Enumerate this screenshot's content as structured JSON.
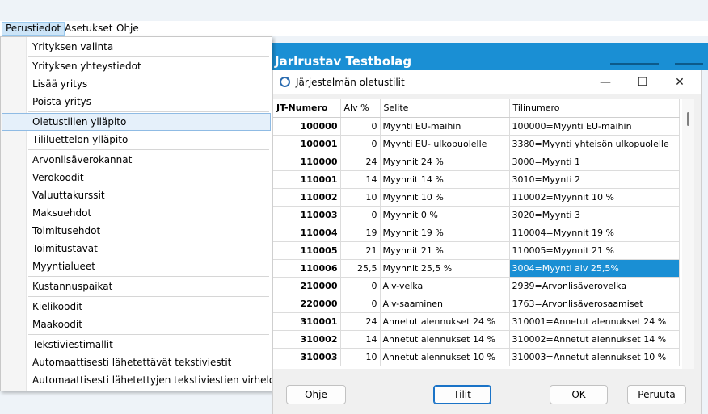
{
  "menubar": {
    "items": [
      "Perustiedot",
      "Asetukset",
      "Ohje"
    ]
  },
  "app": {
    "title": "Jarlrustav Testbolag"
  },
  "dropdown": {
    "items": [
      "Yrityksen valinta",
      "Yrityksen yhteystiedot",
      "Lisää yritys",
      "Poista yritys",
      "Oletustilien ylläpito",
      "Tililuettelon ylläpito",
      "Arvonlisäverokannat",
      "Verokoodit",
      "Valuuttakurssit",
      "Maksuehdot",
      "Toimitusehdot",
      "Toimitustavat",
      "Myyntialueet",
      "Kustannuspaikat",
      "Kielikoodit",
      "Maakoodit",
      "Tekstiviestimallit",
      "Automaattisesti lähetettävät tekstiviestit",
      "Automaattisesti lähetettyjen tekstiviestien virheloki"
    ],
    "active_item": "Oletustilien ylläpito"
  },
  "dialog": {
    "title": "Järjestelmän oletustilit",
    "icon": "refresh-app-icon",
    "window_buttons": {
      "minimize": "—",
      "maximize": "☐",
      "close": "✕"
    },
    "columns": [
      "JT-Numero",
      "Alv %",
      "Selite",
      "Tilinumero"
    ],
    "rows": [
      [
        "100000",
        "0",
        "Myynti EU-maihin",
        "100000=Myynti EU-maihin"
      ],
      [
        "100001",
        "0",
        "Myynti EU- ulkopuolelle",
        "3380=Myynti yhteisön ulkopuolelle"
      ],
      [
        "110000",
        "24",
        "Myynnit 24 %",
        "3000=Myynti 1"
      ],
      [
        "110001",
        "14",
        "Myynnit 14 %",
        "3010=Myynti 2"
      ],
      [
        "110002",
        "10",
        "Myynnit 10 %",
        "110002=Myynnit 10 %"
      ],
      [
        "110003",
        "0",
        "Myynnit 0 %",
        "3020=Myynti 3"
      ],
      [
        "110004",
        "19",
        "Myynnit 19 %",
        "110004=Myynnit 19 %"
      ],
      [
        "110005",
        "21",
        "Myynnit 21 %",
        "110005=Myynnit 21 %"
      ],
      [
        "110006",
        "25,5",
        "Myynnit 25,5 %",
        "3004=Myynti alv 25,5%"
      ],
      [
        "210000",
        "0",
        "Alv-velka",
        "2939=Arvonlisäverovelka"
      ],
      [
        "220000",
        "0",
        "Alv-saaminen",
        "1763=Arvonlisäverosaamiset"
      ],
      [
        "310001",
        "24",
        "Annetut alennukset 24 %",
        "310001=Annetut alennukset 24 %"
      ],
      [
        "310002",
        "14",
        "Annetut alennukset 14 %",
        "310002=Annetut alennukset 14 %"
      ],
      [
        "310003",
        "10",
        "Annetut alennukset 10 %",
        "310003=Annetut alennukset 10 %"
      ]
    ],
    "selected_row": 8,
    "buttons": {
      "help": "Ohje",
      "accounts": "Tilit",
      "ok": "OK",
      "cancel": "Peruuta"
    }
  },
  "colors": {
    "accent": "#1a8fd4",
    "menu_highlight": "#e5f0fa"
  }
}
